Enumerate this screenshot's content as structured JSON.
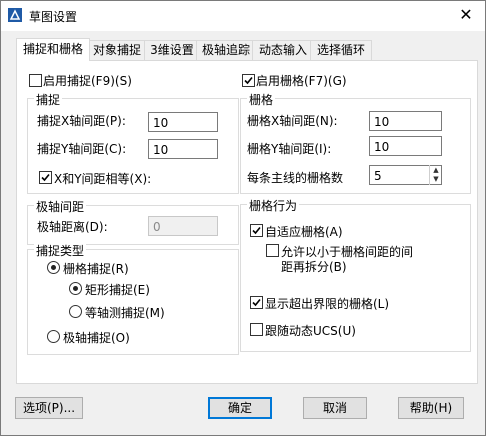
{
  "window": {
    "title": "草图设置",
    "close_symbol": "✕"
  },
  "tabs": [
    {
      "label": "捕捉和栅格",
      "active": true
    },
    {
      "label": "对象捕捉",
      "active": false
    },
    {
      "label": "3维设置",
      "active": false
    },
    {
      "label": "极轴追踪",
      "active": false
    },
    {
      "label": "动态输入",
      "active": false
    },
    {
      "label": "选择循环",
      "active": false
    }
  ],
  "snap_toggle": {
    "label": "启用捕捉(F9)(S)",
    "checked": false
  },
  "grid_toggle": {
    "label": "启用栅格(F7)(G)",
    "checked": true
  },
  "snap_group": {
    "title": "捕捉",
    "x_label": "捕捉X轴间距(P):",
    "x_value": "10",
    "y_label": "捕捉Y轴间距(C):",
    "y_value": "10",
    "equal_label": "X和Y间距相等(X):",
    "equal_checked": true
  },
  "grid_group": {
    "title": "栅格",
    "x_label": "栅格X轴间距(N):",
    "x_value": "10",
    "y_label": "栅格Y轴间距(I):",
    "y_value": "10",
    "major_label": "每条主线的栅格数",
    "major_value": "5"
  },
  "polar_group": {
    "title": "极轴间距",
    "distance_label": "极轴距离(D):",
    "distance_value": "0"
  },
  "snap_type_group": {
    "title": "捕捉类型",
    "grid_snap": "栅格捕捉(R)",
    "rect_snap": "矩形捕捉(E)",
    "iso_snap": "等轴测捕捉(M)",
    "polar_snap": "极轴捕捉(O)"
  },
  "grid_behavior_group": {
    "title": "栅格行为",
    "adaptive_label": "自适应栅格(A)",
    "adaptive_checked": true,
    "subdivide_line1": "允许以小于栅格间距的间",
    "subdivide_line2": "距再拆分(B)",
    "subdivide_checked": false,
    "beyond_label": "显示超出界限的栅格(L)",
    "beyond_checked": true,
    "follow_ucs_label": "跟随动态UCS(U)",
    "follow_ucs_checked": false
  },
  "buttons": {
    "options": "选项(P)...",
    "ok": "确定",
    "cancel": "取消",
    "help": "帮助(H)"
  }
}
